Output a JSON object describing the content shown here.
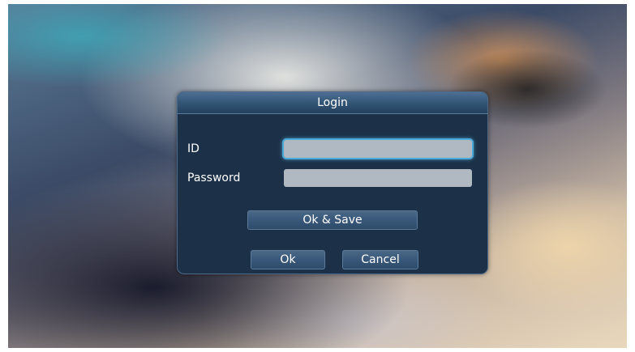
{
  "dialog": {
    "title": "Login",
    "fields": {
      "id": {
        "label": "ID",
        "value": ""
      },
      "password": {
        "label": "Password",
        "value": ""
      }
    },
    "buttons": {
      "ok_save": "Ok & Save",
      "ok": "Ok",
      "cancel": "Cancel"
    }
  },
  "colors": {
    "dialog_background": "#1c3148",
    "title_bar": "#355878",
    "input_background": "#b0b8c2",
    "focus_ring": "#4aa9d8",
    "button": "#39587a"
  }
}
